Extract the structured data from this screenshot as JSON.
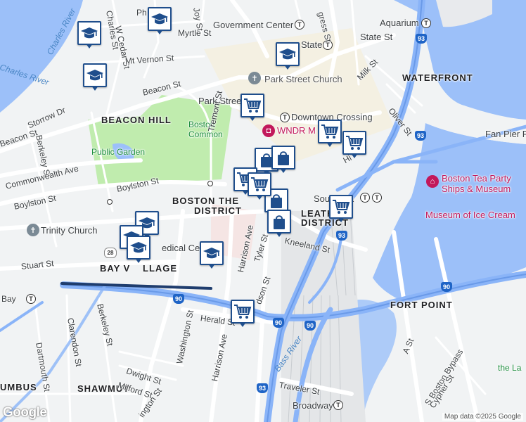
{
  "map": {
    "areas": [
      "BEACON HILL",
      "WATERFRONT",
      "BOSTON THE",
      "DISTRICT",
      "LEATH",
      "DISTRICT",
      "BAY V",
      "LLAGE",
      "FORT POINT",
      "SHAWMUT",
      "UMBUS"
    ],
    "pois": [
      "Government Center",
      "Aquarium",
      "State",
      "State St",
      "Park Street Church",
      "Park Street",
      "Downtown Crossing",
      "WNDR M",
      "Boston Common",
      "Public Garden",
      "Boston Tea Party Ships & Museum",
      "Museum of Ice Cream",
      "Trinity Church",
      "edical Ce",
      "Fan Pier P",
      "the La",
      "Broadway",
      "South Sta"
    ],
    "streets": [
      "Charles St",
      "W Cedar St",
      "Joy St",
      "Myrtle St",
      "Mt Vernon St",
      "Beacon St",
      "Storrow Dr",
      "Berkeley St",
      "Beacon St",
      "Commonwealth Ave",
      "Boylston St",
      "Boylston St",
      "Tremont St",
      "Stuart St",
      "Clarendon St",
      "Dartmouth St",
      "Berkeley St",
      "Washington St",
      "Harrison Ave",
      "Harrison Ave",
      "Herald St",
      "Dwight St",
      "Milford St",
      "ington St",
      "Tyler St",
      "Kneeland St",
      "dson St",
      "Traveler St",
      "Milk St",
      "Oliver St",
      "gress St",
      "A St",
      "S Boston Bypass",
      "Cypher St",
      "Hi",
      "Bay",
      "Ph"
    ],
    "water": [
      "Charles River",
      "Charles River",
      "Bass River"
    ],
    "shields": [
      "93",
      "93",
      "93",
      "90",
      "90",
      "90",
      "90",
      "28"
    ],
    "attribution": "Map data ©2025 Google",
    "logo": "Google"
  },
  "markers": {
    "types": [
      "school",
      "school",
      "school",
      "school",
      "cart",
      "cart",
      "cart",
      "cart",
      "cart",
      "bag",
      "bag",
      "bag",
      "bag",
      "school",
      "school",
      "school",
      "school",
      "cart",
      "cart"
    ]
  },
  "colors": {
    "water": "#9cc0f9",
    "park": "#c0ecae",
    "land": "#f1f3f4",
    "highway": "#8ab4f8",
    "marker_border": "#1f4e8c",
    "road": "#ffffff"
  }
}
